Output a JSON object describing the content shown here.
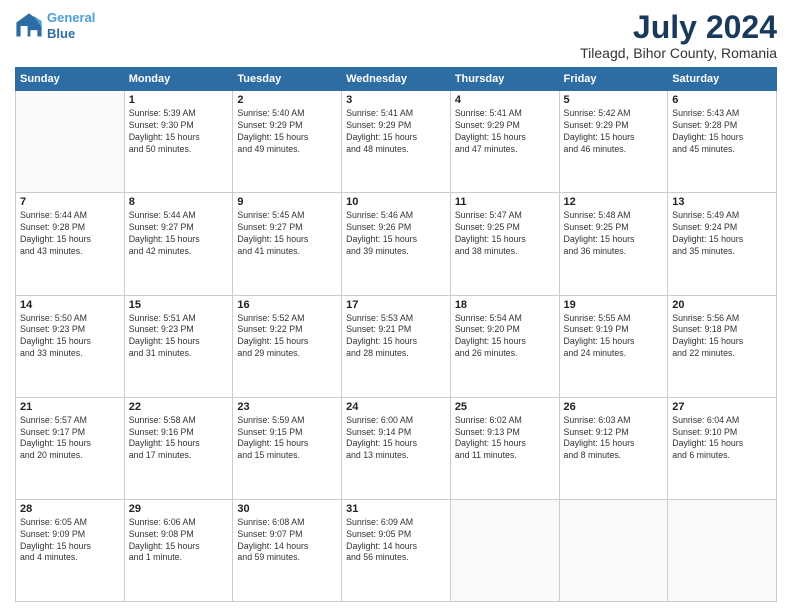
{
  "logo": {
    "line1": "General",
    "line2": "Blue"
  },
  "title": "July 2024",
  "subtitle": "Tileagd, Bihor County, Romania",
  "header_days": [
    "Sunday",
    "Monday",
    "Tuesday",
    "Wednesday",
    "Thursday",
    "Friday",
    "Saturday"
  ],
  "weeks": [
    [
      {
        "day": "",
        "info": ""
      },
      {
        "day": "1",
        "info": "Sunrise: 5:39 AM\nSunset: 9:30 PM\nDaylight: 15 hours\nand 50 minutes."
      },
      {
        "day": "2",
        "info": "Sunrise: 5:40 AM\nSunset: 9:29 PM\nDaylight: 15 hours\nand 49 minutes."
      },
      {
        "day": "3",
        "info": "Sunrise: 5:41 AM\nSunset: 9:29 PM\nDaylight: 15 hours\nand 48 minutes."
      },
      {
        "day": "4",
        "info": "Sunrise: 5:41 AM\nSunset: 9:29 PM\nDaylight: 15 hours\nand 47 minutes."
      },
      {
        "day": "5",
        "info": "Sunrise: 5:42 AM\nSunset: 9:29 PM\nDaylight: 15 hours\nand 46 minutes."
      },
      {
        "day": "6",
        "info": "Sunrise: 5:43 AM\nSunset: 9:28 PM\nDaylight: 15 hours\nand 45 minutes."
      }
    ],
    [
      {
        "day": "7",
        "info": "Sunrise: 5:44 AM\nSunset: 9:28 PM\nDaylight: 15 hours\nand 43 minutes."
      },
      {
        "day": "8",
        "info": "Sunrise: 5:44 AM\nSunset: 9:27 PM\nDaylight: 15 hours\nand 42 minutes."
      },
      {
        "day": "9",
        "info": "Sunrise: 5:45 AM\nSunset: 9:27 PM\nDaylight: 15 hours\nand 41 minutes."
      },
      {
        "day": "10",
        "info": "Sunrise: 5:46 AM\nSunset: 9:26 PM\nDaylight: 15 hours\nand 39 minutes."
      },
      {
        "day": "11",
        "info": "Sunrise: 5:47 AM\nSunset: 9:25 PM\nDaylight: 15 hours\nand 38 minutes."
      },
      {
        "day": "12",
        "info": "Sunrise: 5:48 AM\nSunset: 9:25 PM\nDaylight: 15 hours\nand 36 minutes."
      },
      {
        "day": "13",
        "info": "Sunrise: 5:49 AM\nSunset: 9:24 PM\nDaylight: 15 hours\nand 35 minutes."
      }
    ],
    [
      {
        "day": "14",
        "info": "Sunrise: 5:50 AM\nSunset: 9:23 PM\nDaylight: 15 hours\nand 33 minutes."
      },
      {
        "day": "15",
        "info": "Sunrise: 5:51 AM\nSunset: 9:23 PM\nDaylight: 15 hours\nand 31 minutes."
      },
      {
        "day": "16",
        "info": "Sunrise: 5:52 AM\nSunset: 9:22 PM\nDaylight: 15 hours\nand 29 minutes."
      },
      {
        "day": "17",
        "info": "Sunrise: 5:53 AM\nSunset: 9:21 PM\nDaylight: 15 hours\nand 28 minutes."
      },
      {
        "day": "18",
        "info": "Sunrise: 5:54 AM\nSunset: 9:20 PM\nDaylight: 15 hours\nand 26 minutes."
      },
      {
        "day": "19",
        "info": "Sunrise: 5:55 AM\nSunset: 9:19 PM\nDaylight: 15 hours\nand 24 minutes."
      },
      {
        "day": "20",
        "info": "Sunrise: 5:56 AM\nSunset: 9:18 PM\nDaylight: 15 hours\nand 22 minutes."
      }
    ],
    [
      {
        "day": "21",
        "info": "Sunrise: 5:57 AM\nSunset: 9:17 PM\nDaylight: 15 hours\nand 20 minutes."
      },
      {
        "day": "22",
        "info": "Sunrise: 5:58 AM\nSunset: 9:16 PM\nDaylight: 15 hours\nand 17 minutes."
      },
      {
        "day": "23",
        "info": "Sunrise: 5:59 AM\nSunset: 9:15 PM\nDaylight: 15 hours\nand 15 minutes."
      },
      {
        "day": "24",
        "info": "Sunrise: 6:00 AM\nSunset: 9:14 PM\nDaylight: 15 hours\nand 13 minutes."
      },
      {
        "day": "25",
        "info": "Sunrise: 6:02 AM\nSunset: 9:13 PM\nDaylight: 15 hours\nand 11 minutes."
      },
      {
        "day": "26",
        "info": "Sunrise: 6:03 AM\nSunset: 9:12 PM\nDaylight: 15 hours\nand 8 minutes."
      },
      {
        "day": "27",
        "info": "Sunrise: 6:04 AM\nSunset: 9:10 PM\nDaylight: 15 hours\nand 6 minutes."
      }
    ],
    [
      {
        "day": "28",
        "info": "Sunrise: 6:05 AM\nSunset: 9:09 PM\nDaylight: 15 hours\nand 4 minutes."
      },
      {
        "day": "29",
        "info": "Sunrise: 6:06 AM\nSunset: 9:08 PM\nDaylight: 15 hours\nand 1 minute."
      },
      {
        "day": "30",
        "info": "Sunrise: 6:08 AM\nSunset: 9:07 PM\nDaylight: 14 hours\nand 59 minutes."
      },
      {
        "day": "31",
        "info": "Sunrise: 6:09 AM\nSunset: 9:05 PM\nDaylight: 14 hours\nand 56 minutes."
      },
      {
        "day": "",
        "info": ""
      },
      {
        "day": "",
        "info": ""
      },
      {
        "day": "",
        "info": ""
      }
    ]
  ]
}
